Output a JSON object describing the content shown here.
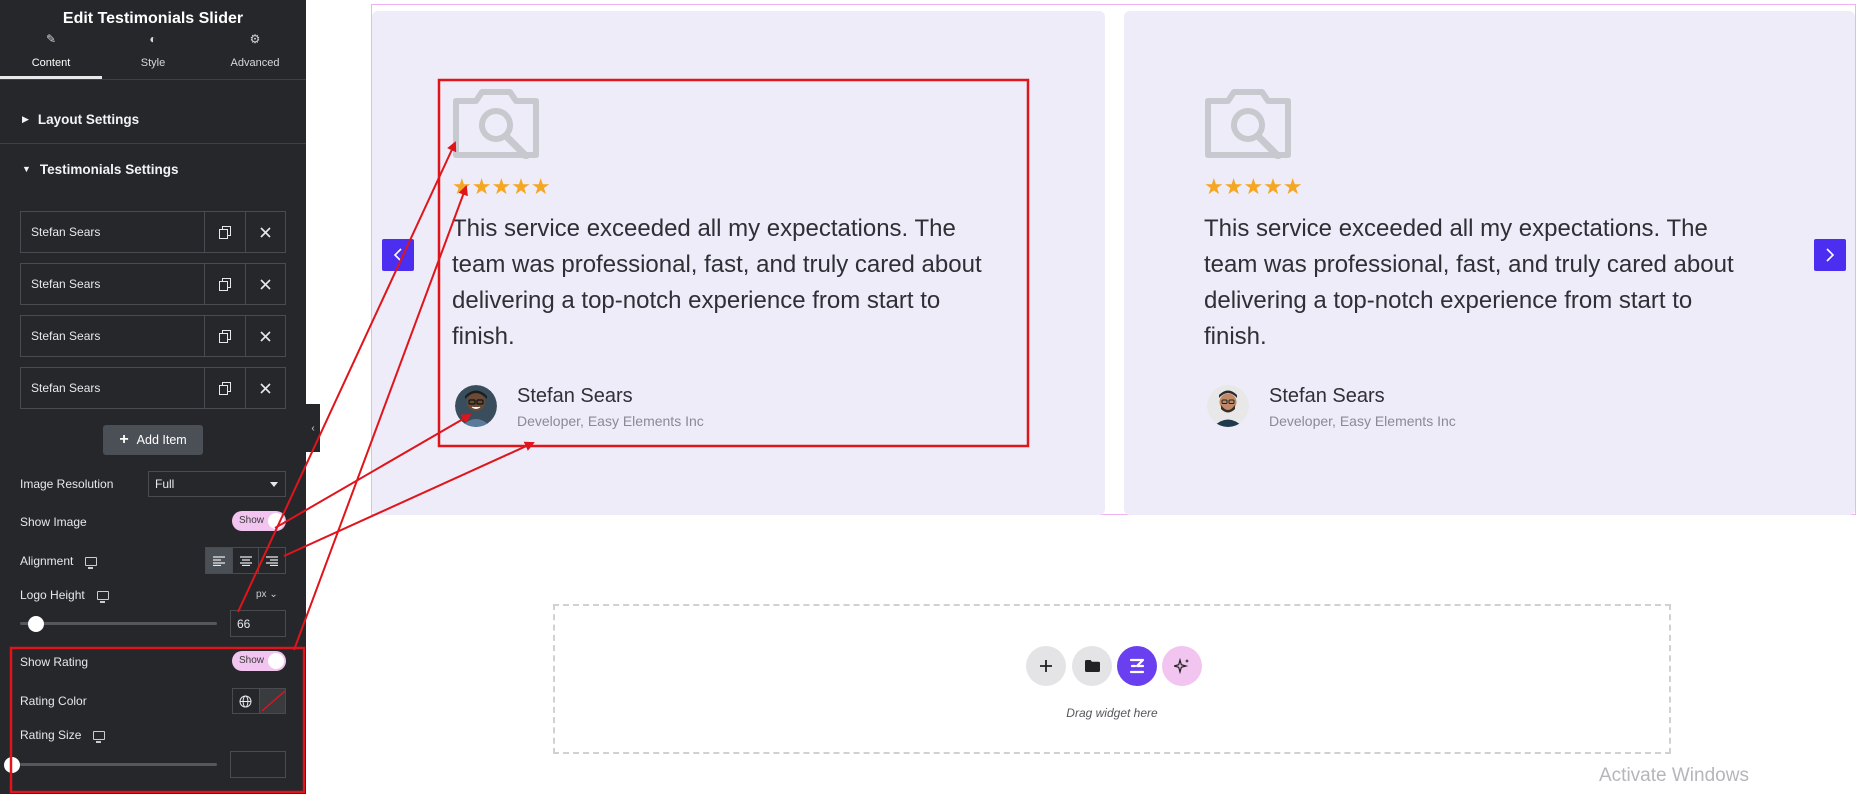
{
  "panel": {
    "title": "Edit Testimonials Slider",
    "tabs": [
      {
        "label": "Content",
        "icon": "pencil-icon",
        "active": true
      },
      {
        "label": "Style",
        "icon": "half-circle-icon",
        "active": false
      },
      {
        "label": "Advanced",
        "icon": "gear-icon",
        "active": false
      }
    ],
    "sections": {
      "layout": "Layout Settings",
      "testimonials": "Testimonials Settings"
    },
    "items": [
      "Stefan Sears",
      "Stefan Sears",
      "Stefan Sears",
      "Stefan Sears"
    ],
    "add_item": "Add Item",
    "controls": {
      "image_resolution": {
        "label": "Image Resolution",
        "value": "Full"
      },
      "show_image": {
        "label": "Show Image",
        "toggle": "Show",
        "on": true
      },
      "alignment": {
        "label": "Alignment",
        "selected": "left"
      },
      "logo_height": {
        "label": "Logo Height",
        "unit": "px",
        "value": "66",
        "slider_fraction": 0.08
      },
      "show_rating": {
        "label": "Show Rating",
        "toggle": "Show",
        "on": true
      },
      "rating_color": {
        "label": "Rating Color"
      },
      "rating_size": {
        "label": "Rating Size",
        "value": "",
        "slider_fraction": 0.0
      }
    }
  },
  "testimonials": [
    {
      "stars": "★★★★★",
      "quote": [
        "This service exceeded all my expectations. The",
        "team was professional, fast, and truly cared about",
        "delivering a top-notch experience from start to",
        "finish."
      ],
      "name": "Stefan Sears",
      "role": "Developer, Easy Elements Inc"
    },
    {
      "stars": "★★★★★",
      "quote": [
        "This service exceeded all my expectations. The",
        "team was professional, fast, and truly cared about",
        "delivering a top-notch experience from start to",
        "finish."
      ],
      "name": "Stefan Sears",
      "role": "Developer, Easy Elements Inc"
    }
  ],
  "drop_zone": {
    "text": "Drag widget here"
  },
  "watermark": "Activate Windows",
  "colors": {
    "panel_bg": "#26272b",
    "card_bg": "#edecf8",
    "star": "#f5a623",
    "arrow": "#4c2ef1",
    "toggle": "#f2c4f0",
    "annotation": "#e0141b"
  }
}
